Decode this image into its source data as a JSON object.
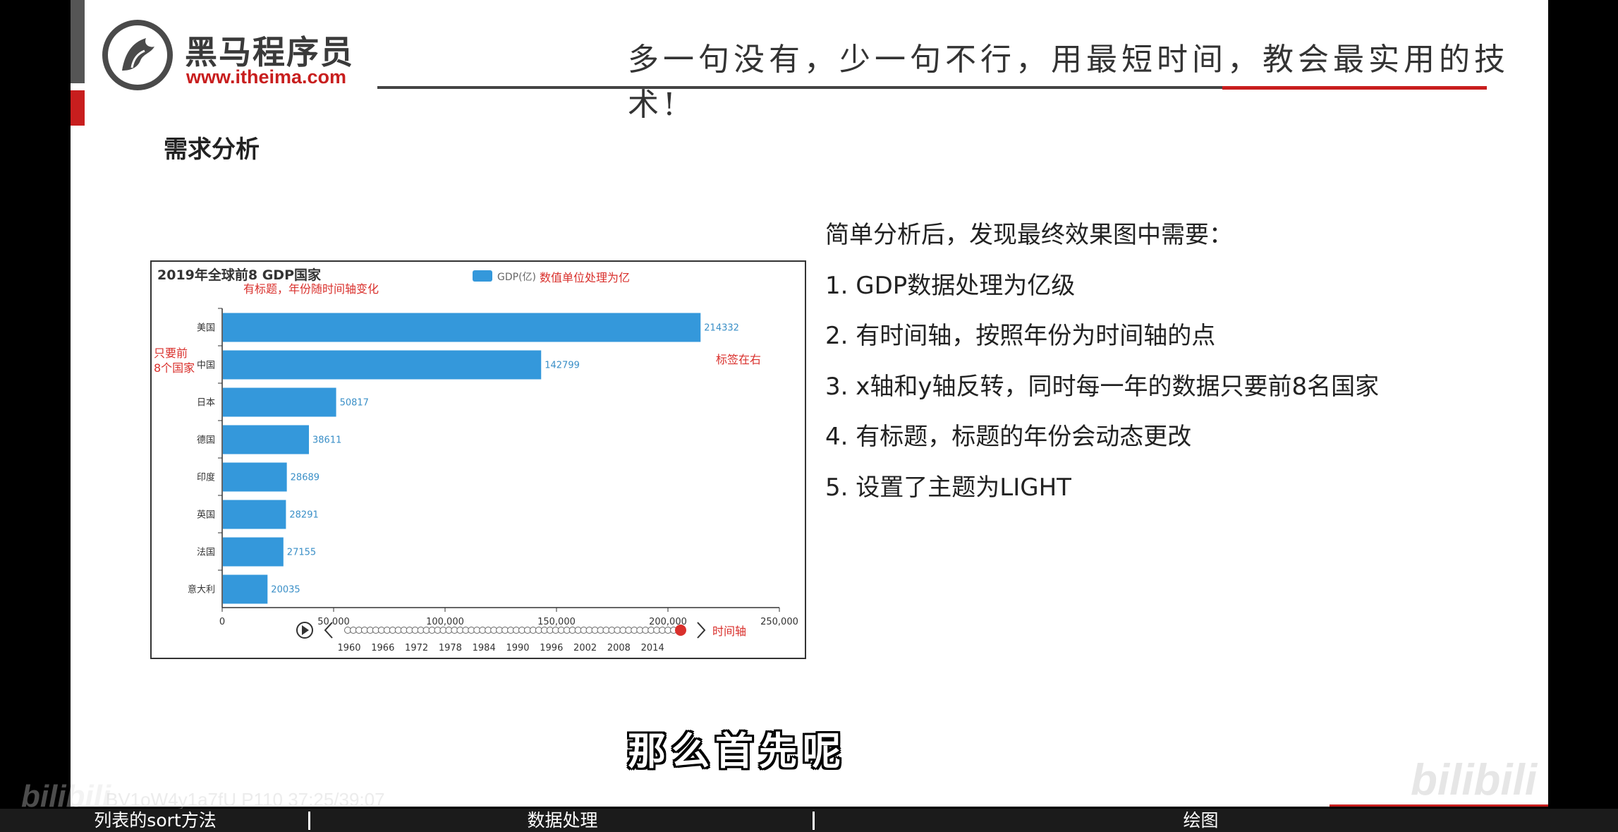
{
  "header": {
    "brand_name": "黑马程序员",
    "brand_url": "www.itheima.com",
    "slogan": "多一句没有，少一句不行，用最短时间，教会最实用的技术!"
  },
  "section_title": "需求分析",
  "chart_annotations": {
    "title_note": "有标题，年份随时间轴变化",
    "legend_note": "数值单位处理为亿",
    "left_note_line1": "只要前",
    "left_note_line2": "8个国家",
    "right_note": "标签在右",
    "timeline_note": "时间轴"
  },
  "chart_data": {
    "type": "bar",
    "orientation": "horizontal",
    "title": "2019年全球前8 GDP国家",
    "legend": [
      "GDP(亿)"
    ],
    "categories": [
      "美国",
      "中国",
      "日本",
      "德国",
      "印度",
      "英国",
      "法国",
      "意大利"
    ],
    "values": [
      214332,
      142799,
      50817,
      38611,
      28689,
      28291,
      27155,
      20035
    ],
    "xlim": [
      0,
      250000
    ],
    "x_ticks": [
      "0",
      "50,000",
      "100,000",
      "150,000",
      "200,000",
      "250,000"
    ],
    "label_position": "right",
    "bar_color": "#3498db",
    "timeline_labels": [
      "1960",
      "1966",
      "1972",
      "1978",
      "1984",
      "1990",
      "1996",
      "2002",
      "2008",
      "2014"
    ],
    "timeline_current": "2019"
  },
  "requirements": {
    "intro": "简单分析后，发现最终效果图中需要：",
    "items": [
      "1. GDP数据处理为亿级",
      "2. 有时间轴，按照年份为时间轴的点",
      "3. x轴和y轴反转，同时每一年的数据只要前8名国家",
      "4. 有标题，标题的年份会动态更改",
      "5. 设置了主题为LIGHT"
    ]
  },
  "video_subtitle": "那么首先呢",
  "watermark": {
    "logo": "bilibili",
    "video_id": "BV1oW4y1a7fU P110 37:25/39:07"
  },
  "chapters": [
    "列表的sort方法",
    "数据处理",
    "绘图"
  ]
}
